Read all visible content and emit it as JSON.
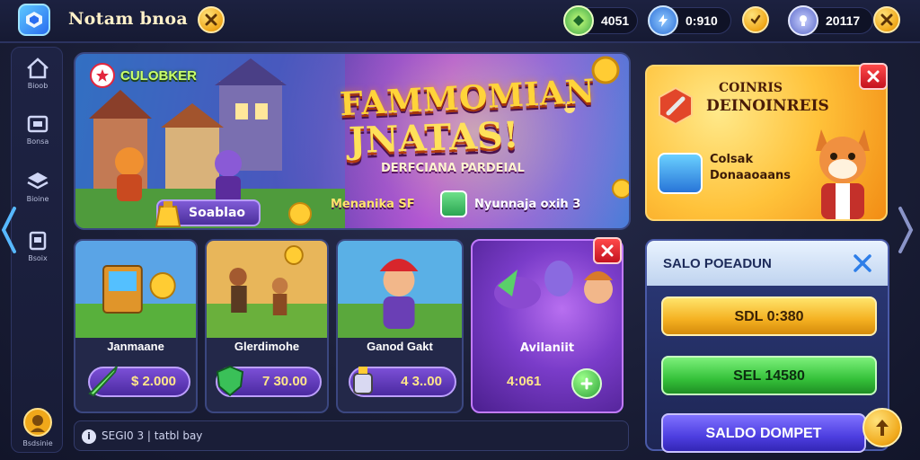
{
  "header": {
    "title": "Notam bnoa",
    "close_icon": "x-icon",
    "stats": [
      {
        "icon": "gem-icon",
        "value": "4051"
      },
      {
        "icon": "lightning-icon",
        "value": "0:910"
      },
      {
        "icon": "shield-check-icon",
        "value": ""
      },
      {
        "icon": "trophy-icon",
        "value": "20117"
      }
    ]
  },
  "sidebar": {
    "items": [
      {
        "icon": "home-icon",
        "label": "Bioob"
      },
      {
        "icon": "store-icon",
        "label": "Bonsa"
      },
      {
        "icon": "layers-icon",
        "label": "Bioine"
      },
      {
        "icon": "box-icon",
        "label": "Bsoix"
      }
    ],
    "profile_label": "Bsdsinie"
  },
  "hero": {
    "tag": "CULOBKER",
    "title_line1": "FAMMOMIAN",
    "title_line2": "JNATAS!",
    "subtitle": "DERFCIANA PARDEIAL",
    "button_label": "Soablao",
    "footer_left": "Menanika SF",
    "footer_right": "Nyunnaja oxih 3"
  },
  "cards": [
    {
      "name": "Janmaane",
      "price": "$ 2.000"
    },
    {
      "name": "Glerdimohe",
      "price": "7 30.00"
    },
    {
      "name": "Ganod Gakt",
      "price": "4 3..00"
    },
    {
      "name": "Avilaniit",
      "price": "4:061"
    }
  ],
  "footer": {
    "info_icon": "info-icon",
    "text": "SEGI0 3 | tatbl bay"
  },
  "promo": {
    "title_line1": "COINRIS",
    "title_line2": "DEINOINREIS",
    "sub_line1": "Colsak",
    "sub_line2": "Donaaoaans"
  },
  "wallet": {
    "title": "SALO POEADUN",
    "buttons": [
      "SDL 0:380",
      "SEL 14580",
      "SALDO DOMPET"
    ]
  },
  "colors": {
    "accent_gold": "#f4b020",
    "accent_green": "#35c13a",
    "accent_violet": "#4d3ee0",
    "close_red": "#c4121f"
  }
}
